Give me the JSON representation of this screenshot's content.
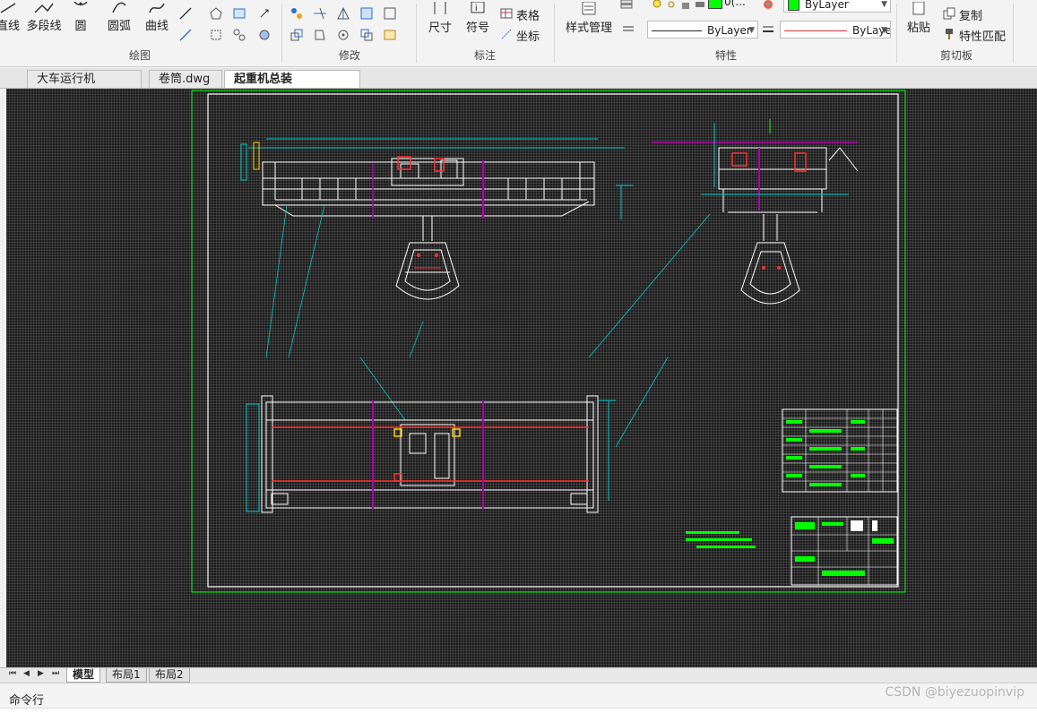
{
  "ribbon": {
    "draw": {
      "title": "绘图",
      "line_label": "直线",
      "polyline_label": "多段线",
      "circle_label": "圆",
      "arc_label": "圆弧",
      "curve_label": "曲线"
    },
    "modify": {
      "title": "修改"
    },
    "annotation": {
      "title": "标注",
      "dimension_label": "尺寸",
      "symbol_label": "符号",
      "table_label": "表格",
      "coordinate_label": "坐标"
    },
    "properties": {
      "title": "特性",
      "style_manager_label": "样式管理",
      "color_value": "ByLayer",
      "linetype_value": "ByLayer",
      "lineweight_value": "ByLayer",
      "layer_value": "0(...",
      "layer_color": "#00ff00"
    },
    "clipboard": {
      "title": "剪切板",
      "paste_label": "粘贴",
      "copy_label": "复制",
      "match_label": "特性匹配"
    }
  },
  "document_tabs": [
    {
      "label": "大车运行机构.dwg",
      "active": false
    },
    {
      "label": "卷筒.dwg",
      "active": false
    },
    {
      "label": "起重机总装图.dwg*",
      "active": true
    }
  ],
  "layout_tabs": [
    {
      "label": "模型",
      "active": true
    },
    {
      "label": "布局1",
      "active": false
    },
    {
      "label": "布局2",
      "active": false
    }
  ],
  "command_line": {
    "label": "命令行"
  },
  "watermark": "CSDN @biyezuopinvip",
  "colors": {
    "canvas_bg": "#1b1b1b",
    "cad_white": "#ffffff",
    "cad_green": "#00ff00",
    "cad_cyan": "#00c8c8",
    "cad_red": "#ff3030",
    "cad_magenta": "#b000b0",
    "cad_yellow": "#ffd000"
  }
}
